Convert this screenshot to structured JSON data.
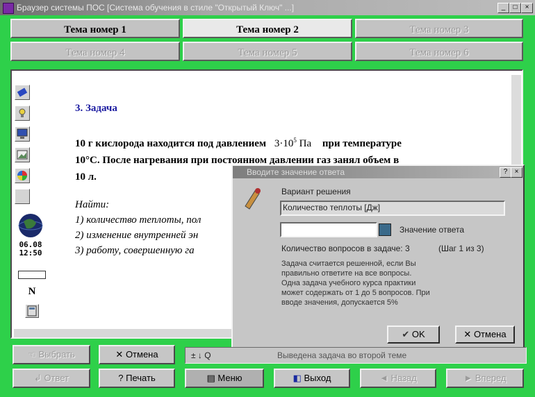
{
  "window": {
    "title": "Браузер системы ПОС [Система обучения в стиле \"Открытый Ключ\" ...]",
    "buttons": [
      "_",
      "□",
      "×"
    ]
  },
  "tabs": [
    {
      "label": "Тема номер 1",
      "state": "normal"
    },
    {
      "label": "Тема номер 2",
      "state": "active"
    },
    {
      "label": "Тема номер 3",
      "state": "disabled"
    },
    {
      "label": "Тема номер 4",
      "state": "disabled"
    },
    {
      "label": "Тема номер 5",
      "state": "disabled"
    },
    {
      "label": "Тема номер 6",
      "state": "disabled"
    }
  ],
  "toolbar": {
    "date": "06.08",
    "time": "12:50",
    "letter": "N",
    "icons": [
      "eraser-icon",
      "lightbulb-icon",
      "monitor-icon",
      "picture-icon",
      "palette-icon",
      "blank-icon",
      "globe-icon",
      "calculator-icon"
    ]
  },
  "task": {
    "heading": "3. Задача",
    "line1_a": "10 г кислорода находится под давлением",
    "formula_coef": "3·10",
    "formula_exp": "5",
    "formula_unit": "Па",
    "line1_b": "при температуре",
    "line2": "10°С. После нагревания при постоянном давлении газ занял объем в",
    "line3": "10 л.",
    "find_label": "Найти:",
    "items": [
      "1) количество теплоты, пол",
      "2) изменение внутренней эн",
      "3) работу, совершенную га"
    ]
  },
  "dialog": {
    "title": "Вводите значение ответа",
    "variant_label": "Вариант решения",
    "variant_value": "Количество теплоты [Дж]",
    "answer_value": "",
    "answer_label": "Значение ответа",
    "question_count": "Количество вопросов в задаче: 3",
    "step": "(Шаг 1 из 3)",
    "info_lines": [
      "Задача считается решенной, если Вы",
      "правильно ответите на все вопросы.",
      "Одна задача учебного курса практики",
      "может содержать от 1 до 5 вопросов. При",
      "вводе значения, допускается 5%"
    ],
    "ok": "OK",
    "cancel": "Отмена"
  },
  "bottom": {
    "row1": [
      {
        "label": "Выбрать",
        "state": "disabled"
      },
      {
        "label": "Отмена",
        "state": "normal"
      }
    ],
    "row2": [
      {
        "label": "Ответ",
        "state": "disabled"
      },
      {
        "label": "Печать",
        "state": "normal"
      },
      {
        "label": "Меню",
        "state": "dark"
      },
      {
        "label": "Выход",
        "state": "normal"
      },
      {
        "label": "Назад",
        "state": "disabled"
      },
      {
        "label": "Вперед",
        "state": "disabled"
      }
    ],
    "status_text": "Выведена задача во второй теме"
  },
  "colors": {
    "background": "#2ed04a",
    "heading": "#1a1aa0"
  }
}
